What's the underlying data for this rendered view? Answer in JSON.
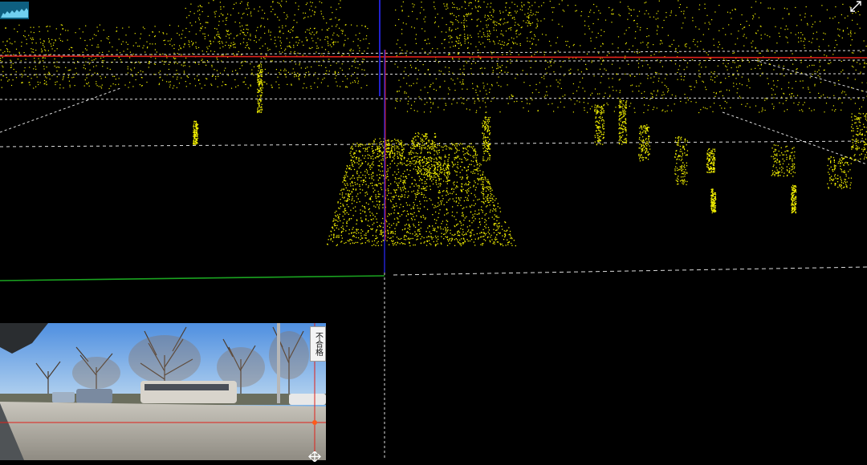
{
  "viewer": {
    "background": "#000000",
    "point_color": "#f2ef00",
    "axis_colors": {
      "x": "#e0201a",
      "y": "#1aa320",
      "z": "#2a2aff"
    }
  },
  "toolbar": {
    "minimap_icon": "point-density-minimap-icon",
    "expand_icon": "expand-arrows-icon"
  },
  "camera_preview": {
    "status_label": "不合格",
    "move_icon": "move-arrows-icon"
  }
}
